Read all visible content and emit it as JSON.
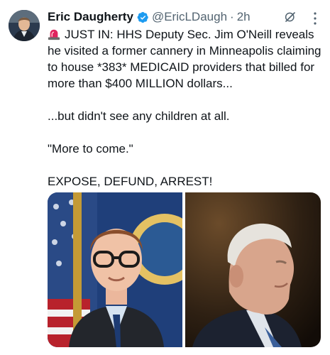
{
  "tweet": {
    "author": {
      "display_name": "Eric Daugherty",
      "handle": "@EricLDaugh",
      "separator": "·",
      "time": "2h"
    },
    "icons": {
      "verified": "verified-badge-icon",
      "grok": "grok-icon",
      "more": "more-options-icon",
      "siren": "siren-emoji-icon"
    },
    "colors": {
      "verified": "#1d9bf0",
      "text": "#0f1419",
      "muted": "#536471"
    },
    "text": {
      "line1": "JUST IN: HHS Deputy Sec. Jim O'Neill reveals he visited a former cannery in Minneapolis claiming to house *383* MEDICAID providers that billed for more than $400 MILLION dollars...",
      "line2": "...but didn't see any children at all.",
      "line3": "\"More to come.\"",
      "line4": "EXPOSE, DEFUND, ARREST!"
    }
  }
}
